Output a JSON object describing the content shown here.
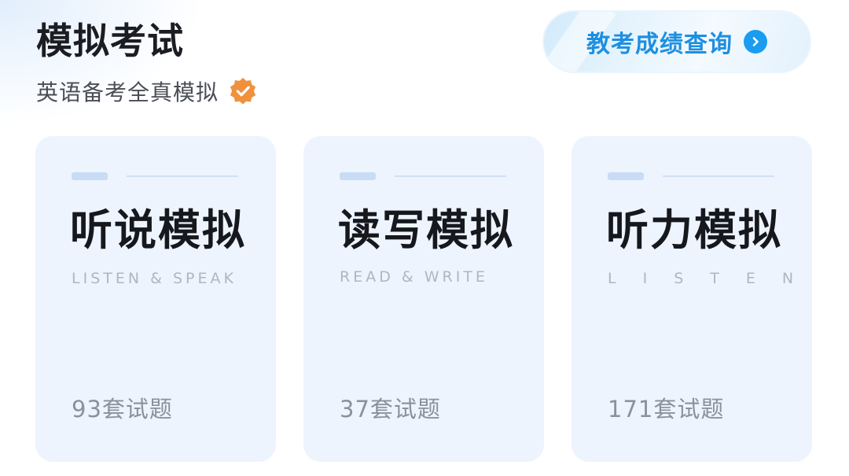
{
  "header": {
    "title": "模拟考试",
    "subtitle": "英语备考全真模拟",
    "verified_icon": "verified-badge-icon",
    "query_button": {
      "label": "教考成绩查询",
      "icon": "chevron-right-circle-icon"
    }
  },
  "colors": {
    "accent": "#1a9cf0",
    "badge": "#f0913e",
    "card_bg": "#edf4fd",
    "title": "#1c1d22",
    "muted": "#8b919b"
  },
  "cards": [
    {
      "title": "听说模拟",
      "subtitle": "LISTEN & SPEAK",
      "count": "93套试题"
    },
    {
      "title": "读写模拟",
      "subtitle": "READ & WRITE",
      "count": "37套试题"
    },
    {
      "title": "听力模拟",
      "subtitle": "LISTEN",
      "count": "171套试题"
    }
  ]
}
